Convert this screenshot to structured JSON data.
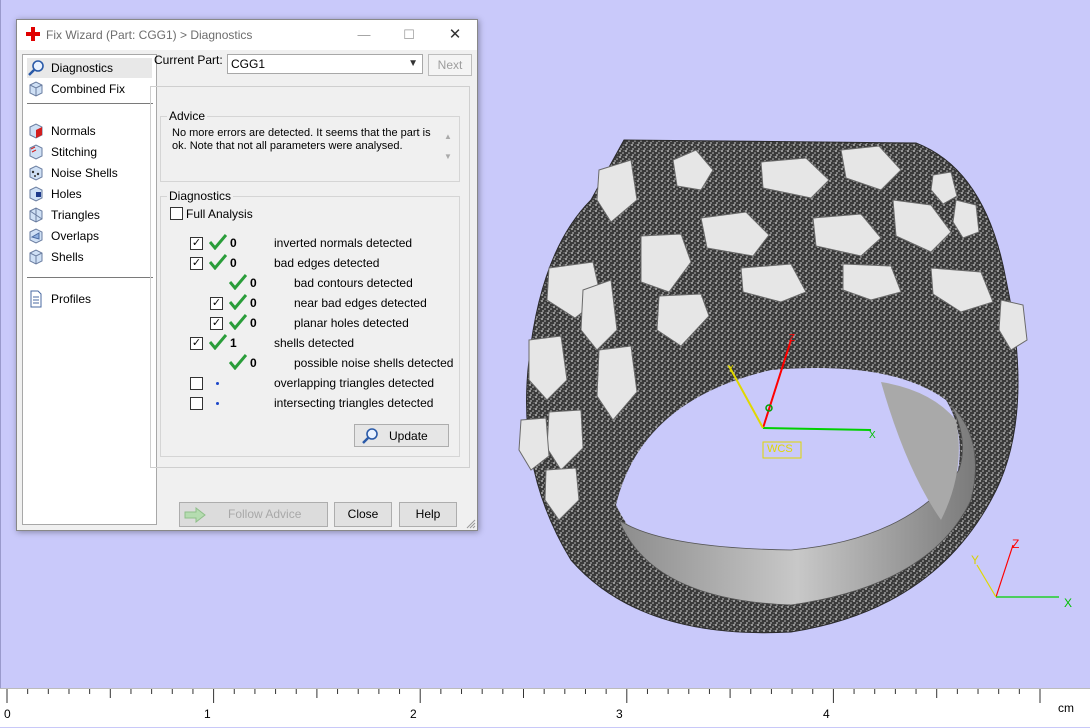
{
  "dialog": {
    "title": "Fix Wizard (Part: CGG1) > Diagnostics",
    "nav": [
      {
        "label": "Diagnostics",
        "icon": "magnifier-icon"
      },
      {
        "label": "Combined Fix",
        "icon": "cube-icon"
      },
      {
        "label": "Normals",
        "icon": "normals-cube-icon"
      },
      {
        "label": "Stitching",
        "icon": "stitching-icon"
      },
      {
        "label": "Noise Shells",
        "icon": "noise-shells-icon"
      },
      {
        "label": "Holes",
        "icon": "holes-icon"
      },
      {
        "label": "Triangles",
        "icon": "triangles-icon"
      },
      {
        "label": "Overlaps",
        "icon": "overlaps-icon"
      },
      {
        "label": "Shells",
        "icon": "shells-icon"
      },
      {
        "label": "Profiles",
        "icon": "document-icon"
      }
    ],
    "current_part_label": "Current Part:",
    "current_part_value": "CGG1",
    "next_label": "Next",
    "advice": {
      "title": "Advice",
      "text": "No more errors are detected. It seems that the part is ok. Note that not all parameters were analysed."
    },
    "diagnostics": {
      "title": "Diagnostics",
      "full_analysis_label": "Full Analysis",
      "rows": [
        {
          "count": "0",
          "label": "inverted normals detected"
        },
        {
          "count": "0",
          "label": "bad edges detected"
        },
        {
          "count": "0",
          "label": "bad contours detected"
        },
        {
          "count": "0",
          "label": "near bad edges detected"
        },
        {
          "count": "0",
          "label": "planar holes detected"
        },
        {
          "count": "1",
          "label": "shells detected"
        },
        {
          "count": "0",
          "label": "possible noise shells detected"
        },
        {
          "count": "",
          "label": "overlapping triangles detected"
        },
        {
          "count": "",
          "label": "intersecting triangles detected"
        }
      ],
      "update_label": "Update"
    },
    "buttons": {
      "follow_advice": "Follow Advice",
      "close": "Close",
      "help": "Help"
    }
  },
  "viewport": {
    "wcs_label": "WCS",
    "axes": {
      "x": "X",
      "y": "Y",
      "z": "Z"
    }
  },
  "ruler": {
    "numbers": [
      "0",
      "1",
      "2",
      "3",
      "4"
    ],
    "unit": "cm"
  },
  "colors": {
    "viewport_bg": "#c9c9fa",
    "check_green": "#2a9d3a",
    "axis_x": "#00cc00",
    "axis_y": "#e6d800",
    "axis_z": "#ff0000"
  }
}
